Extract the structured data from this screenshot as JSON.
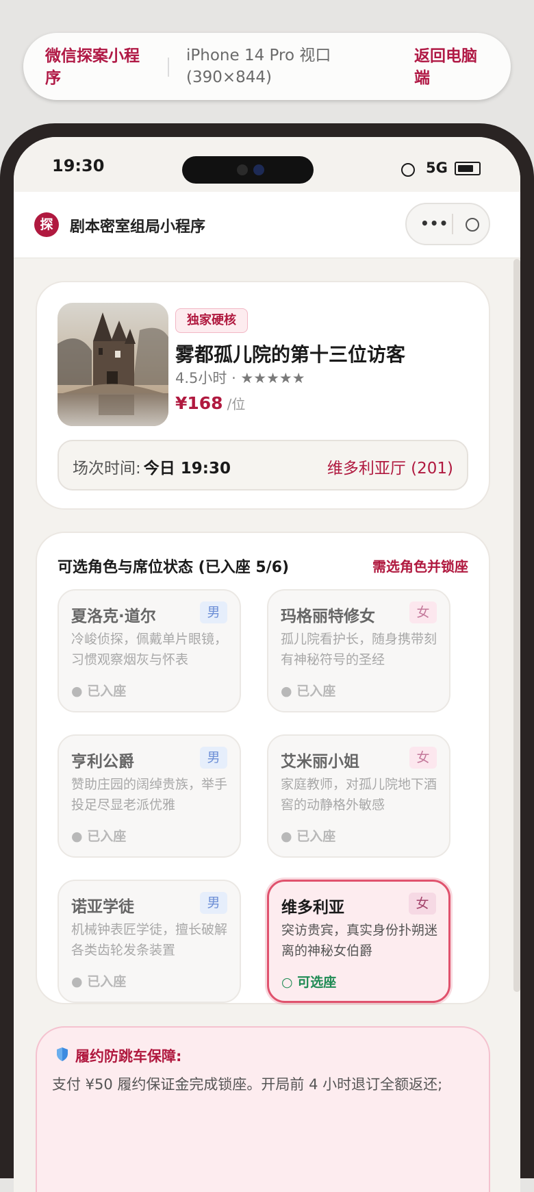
{
  "top_bar": {
    "title": "微信探案小程序",
    "viewport": "iPhone 14 Pro 视口 (390×844)",
    "back_label": "返回电脑端"
  },
  "status_bar": {
    "time": "19:30",
    "network": "5G"
  },
  "mini_nav": {
    "logo_char": "探",
    "title": "剧本密室组局小程序",
    "more_icon": "more-dots-icon",
    "close_icon": "circle-close-icon"
  },
  "script": {
    "badge": "独家硬核",
    "title": "雾都孤儿院的第十三位访客",
    "meta": "4.5小时 · ★★★★★",
    "price": "¥168",
    "price_unit": "/位",
    "session_label": "场次时间:",
    "session_time": "今日 19:30",
    "room": "维多利亚厅 (201)"
  },
  "roles_section": {
    "title": "可选角色与席位状态 (已入座 5/6)",
    "hint": "需选角色并锁座",
    "roles": [
      {
        "name": "夏洛克·道尔",
        "gender": "男",
        "desc": "冷峻侦探，佩戴单片眼镜，习惯观察烟灰与怀表",
        "status": "● 已入座"
      },
      {
        "name": "玛格丽特修女",
        "gender": "女",
        "desc": "孤儿院看护长，随身携带刻有神秘符号的圣经",
        "status": "● 已入座"
      },
      {
        "name": "亨利公爵",
        "gender": "男",
        "desc": "赞助庄园的阔绰贵族，举手投足尽显老派优雅",
        "status": "● 已入座"
      },
      {
        "name": "艾米丽小姐",
        "gender": "女",
        "desc": "家庭教师，对孤儿院地下酒窖的动静格外敏感",
        "status": "● 已入座"
      },
      {
        "name": "诺亚学徒",
        "gender": "男",
        "desc": "机械钟表匠学徒，擅长破解各类齿轮发条装置",
        "status": "● 已入座"
      },
      {
        "name": "维多利亚",
        "gender": "女",
        "desc": "突访贵宾，真实身份扑朔迷离的神秘女伯爵",
        "status": "○ 可选座"
      }
    ]
  },
  "guarantee": {
    "title": "履约防跳车保障:",
    "text": "支付 ¥50 履约保证金完成锁座。开局前 4 小时退订全额返还;"
  },
  "colors": {
    "brand": "#b0193f",
    "available": "#1f8b54",
    "male_tag": "#6d8fd6",
    "female_tag": "#c3789a"
  }
}
